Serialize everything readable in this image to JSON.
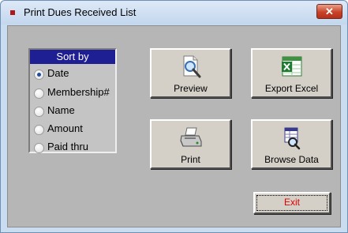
{
  "window": {
    "title": "Print Dues Received List",
    "close_glyph": "✕"
  },
  "sort": {
    "header": "Sort by",
    "selected": "Date",
    "options": [
      "Date",
      "Membership#",
      "Name",
      "Amount",
      "Paid thru"
    ]
  },
  "buttons": {
    "preview": "Preview",
    "export_excel": "Export Excel",
    "print": "Print",
    "browse_data": "Browse Data",
    "exit": "Exit"
  },
  "icons": {
    "preview": "magnifier-page-icon",
    "export_excel": "excel-icon",
    "print": "printer-icon",
    "browse_data": "binoculars-grid-icon"
  },
  "colors": {
    "sort_header_bg": "#1e1f92",
    "exit_text": "#e00000",
    "close_button": "#c94329"
  }
}
